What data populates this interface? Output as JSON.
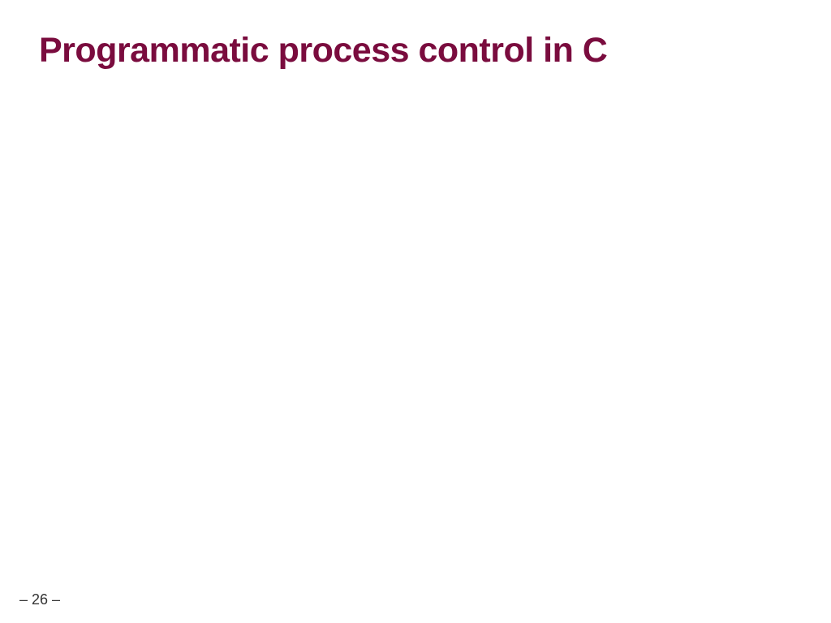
{
  "slide": {
    "title": "Programmatic process control in C",
    "page_number": "– 26 –"
  }
}
